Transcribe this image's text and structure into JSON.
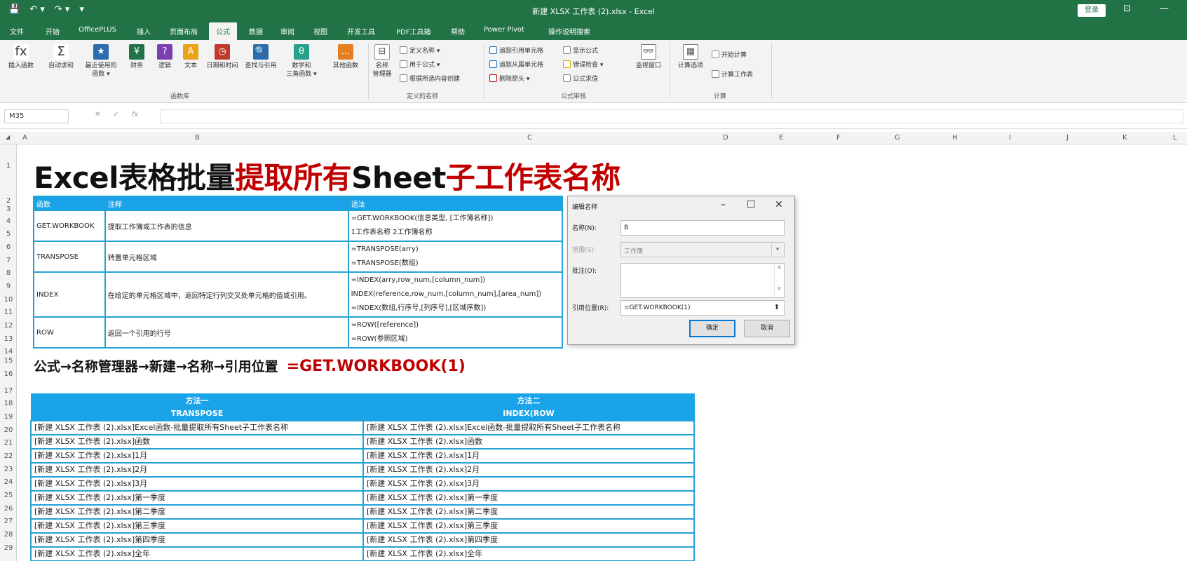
{
  "window": {
    "title": "新建 XLSX 工作表 (2).xlsx  -  Excel",
    "login_label": "登录",
    "quick_access": [
      "💾",
      "↶ ▾",
      "↷ ▾",
      "▾"
    ],
    "controls": [
      "⊡",
      "—"
    ]
  },
  "menu": {
    "tabs": [
      "文件",
      "开始",
      "OfficePLUS",
      "插入",
      "页面布局",
      "公式",
      "数据",
      "审阅",
      "视图",
      "开发工具",
      "PDF工具箱",
      "帮助",
      "Power Pivot",
      "操作说明搜索"
    ],
    "active_tab": "公式"
  },
  "ribbon": {
    "function_library": {
      "group_label": "函数库",
      "buttons": [
        {
          "label": "插入函数",
          "icon": "fx"
        },
        {
          "label": "自动求和",
          "icon": "Σ"
        },
        {
          "label": "最近使用的\n函数 ▾",
          "icon": "★"
        },
        {
          "label": "财务",
          "icon": "¥"
        },
        {
          "label": "逻辑",
          "icon": "?"
        },
        {
          "label": "文本",
          "icon": "A"
        },
        {
          "label": "日期和时间",
          "icon": "◷"
        },
        {
          "label": "查找与引用",
          "icon": "🔍"
        },
        {
          "label": "数学和\n三角函数 ▾",
          "icon": "θ"
        },
        {
          "label": "其他函数",
          "icon": "…"
        }
      ]
    },
    "defined_names": {
      "group_label": "定义的名称",
      "manager_label": "名称\n管理器",
      "items": [
        "定义名称 ▾",
        "用于公式 ▾",
        "根据所选内容创建"
      ]
    },
    "formula_auditing": {
      "group_label": "公式审核",
      "items": [
        "追踪引用单元格",
        "追踪从属单元格",
        "删除箭头 ▾",
        "显示公式",
        "错误检查 ▾",
        "公式求值"
      ],
      "watch_label": "监视窗口"
    },
    "calculation": {
      "group_label": "计算",
      "options_label": "计算选项",
      "items": [
        "开始计算",
        "计算工作表"
      ]
    }
  },
  "formula_bar": {
    "name_box": "M35",
    "formula": ""
  },
  "sheet": {
    "columns": [
      "A",
      "B",
      "C",
      "D",
      "E",
      "F",
      "G",
      "H",
      "I",
      "J",
      "K",
      "L"
    ],
    "rows": [
      "1",
      "2",
      "3",
      "4",
      "5",
      "6",
      "7",
      "8",
      "9",
      "10",
      "11",
      "12",
      "13",
      "14",
      "15",
      "16",
      "17",
      "18",
      "19",
      "20",
      "21",
      "22",
      "23",
      "24",
      "25",
      "26",
      "27",
      "28",
      "29"
    ],
    "title_parts": [
      {
        "text": "Excel表格批量",
        "color": "black"
      },
      {
        "text": "提取所有",
        "color": "red"
      },
      {
        "text": "Sheet",
        "color": "black"
      },
      {
        "text": "子工作表名称",
        "color": "red"
      }
    ],
    "function_table": {
      "headers": [
        "函数",
        "注释",
        "语法"
      ],
      "rows": [
        {
          "func": "GET.WORKBOOK",
          "note": "提取工作簿或工作表的信息",
          "syntax": [
            "=GET.WORKBOOK(信息类型, [工作簿名称])",
            "1工作表名称 2工作簿名称"
          ]
        },
        {
          "func": "TRANSPOSE",
          "note": "转置单元格区域",
          "syntax": [
            "=TRANSPOSE(arry)",
            "=TRANSPOSE(数组)"
          ]
        },
        {
          "func": "INDEX",
          "note": "在给定的单元格区域中，返回特定行列交叉处单元格的值或引用。",
          "syntax": [
            "=INDEX(arry,row_num,[column_num])",
            "INDEX(reference,row_num,[column_num],[area_num])",
            "=INDEX(数组,行序号,[列序号],[区域序数])"
          ]
        },
        {
          "func": "ROW",
          "note": "返回一个引用的行号",
          "syntax": [
            "=ROW([reference])",
            "=ROW(参照区域)"
          ]
        }
      ]
    },
    "steps_text": "公式→名称管理器→新建→名称→引用位置",
    "steps_formula": "=GET.WORKBOOK(1)",
    "result_table": {
      "method1_title": "方法一",
      "method1_sub": "TRANSPOSE",
      "method2_title": "方法二",
      "method2_sub": "INDEX(ROW",
      "rows": [
        "[新建 XLSX 工作表 (2).xlsx]Excel函数-批量提取所有Sheet子工作表名称",
        "[新建 XLSX 工作表 (2).xlsx]函数",
        "[新建 XLSX 工作表 (2).xlsx]1月",
        "[新建 XLSX 工作表 (2).xlsx]2月",
        "[新建 XLSX 工作表 (2).xlsx]3月",
        "[新建 XLSX 工作表 (2).xlsx]第一季度",
        "[新建 XLSX 工作表 (2).xlsx]第二季度",
        "[新建 XLSX 工作表 (2).xlsx]第三季度",
        "[新建 XLSX 工作表 (2).xlsx]第四季度",
        "[新建 XLSX 工作表 (2).xlsx]全年"
      ]
    }
  },
  "dialog": {
    "title": "编辑名称",
    "name_label": "名称(N):",
    "name_value": "B",
    "scope_label": "范围(S):",
    "scope_value": "工作簿",
    "comment_label": "批注(O):",
    "comment_value": "",
    "refers_label": "引用位置(R):",
    "refers_value": "=GET.WORKBOOK(1)",
    "ok_label": "确定",
    "cancel_label": "取消"
  },
  "colors": {
    "excel_green": "#217346",
    "header_blue": "#1aa3e8",
    "border_blue": "#23a3d4",
    "title_red": "#c00000"
  }
}
